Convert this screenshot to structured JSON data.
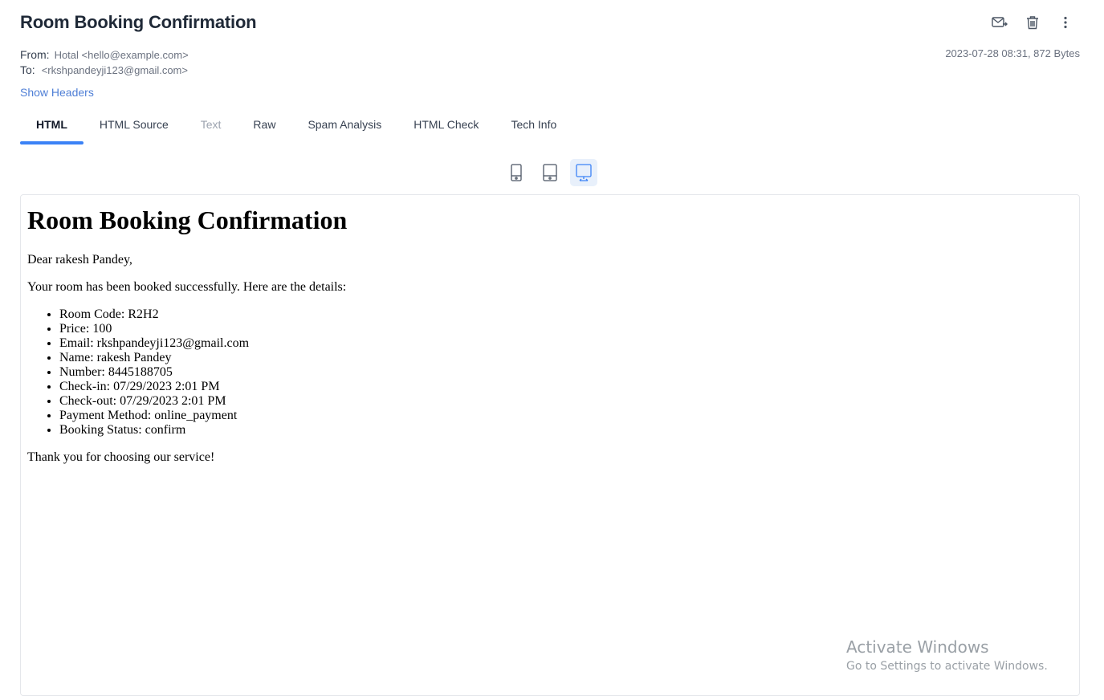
{
  "header": {
    "subject": "Room Booking Confirmation",
    "from_label": "From:",
    "from_value": "Hotal <hello@example.com>",
    "to_label": "To:",
    "to_value": "<rkshpandeyji123@gmail.com>",
    "date_size": "2023-07-28 08:31, 872 Bytes",
    "show_headers": "Show Headers",
    "actions": [
      "forward-mail-icon",
      "trash-icon",
      "more-vertical-icon"
    ]
  },
  "tabs": [
    {
      "label": "HTML",
      "active": true
    },
    {
      "label": "HTML Source"
    },
    {
      "label": "Text",
      "disabled": true
    },
    {
      "label": "Raw"
    },
    {
      "label": "Spam Analysis"
    },
    {
      "label": "HTML Check"
    },
    {
      "label": "Tech Info"
    }
  ],
  "devices": [
    "mobile-icon",
    "tablet-icon",
    "desktop-icon"
  ],
  "active_device": "desktop",
  "email": {
    "title": "Room Booking Confirmation",
    "greeting": "Dear rakesh Pandey,",
    "intro": "Your room has been booked successfully. Here are the details:",
    "details": [
      "Room Code: R2H2",
      "Price: 100",
      "Email: rkshpandeyji123@gmail.com",
      "Name: rakesh Pandey",
      "Number: 8445188705",
      "Check-in: 07/29/2023 2:01 PM",
      "Check-out: 07/29/2023 2:01 PM",
      "Payment Method: online_payment",
      "Booking Status: confirm"
    ],
    "closing": "Thank you for choosing our service!"
  },
  "watermark": {
    "line1": "Activate Windows",
    "line2": "Go to Settings to activate Windows."
  },
  "colors": {
    "accent": "#3b82f6",
    "link": "#4f7fd6",
    "muted": "#6b7280"
  }
}
